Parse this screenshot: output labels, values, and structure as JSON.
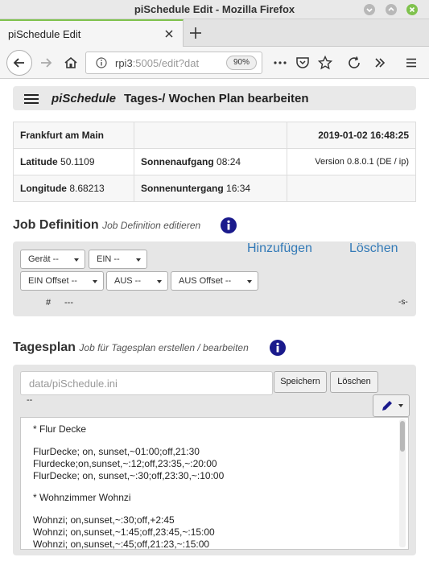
{
  "window": {
    "title": "piSchedule Edit - Mozilla Firefox"
  },
  "tab": {
    "title": "piSchedule Edit"
  },
  "urlbar": {
    "url_host": "rpi3",
    "url_rest": ":5005/edit?dat",
    "zoom": "90%"
  },
  "app": {
    "brand": "piSchedule",
    "title": "Tages-/ Wochen Plan bearbeiten"
  },
  "info": {
    "city": "Frankfurt am Main",
    "datetime": "2019-01-02 16:48:25",
    "lat_label": "Latitude",
    "lat_value": "50.1109",
    "sunrise_label": "Sonnenaufgang",
    "sunrise_value": "08:24",
    "version": "Version 0.8.0.1 (DE / ip)",
    "lon_label": "Longitude",
    "lon_value": "8.68213",
    "sunset_label": "Sonnenuntergang",
    "sunset_value": "16:34"
  },
  "job": {
    "title": "Job Definition",
    "subtitle": "Job Definition editieren",
    "add_label": "Hinzufügen",
    "delete_label": "Löschen",
    "dropdowns": {
      "geraet": "Gerät  --",
      "ein": "EIN  --",
      "ein_offset": "EIN Offset  --",
      "aus": "AUS  --",
      "aus_offset": "AUS Offset  --"
    },
    "hash": "#",
    "hash_value": "---",
    "s_label": "-s-"
  },
  "plan": {
    "title": "Tagesplan",
    "subtitle": "Job für Tagesplan erstellen / bearbeiten",
    "file_placeholder": "data/piSchedule.ini",
    "save_label": "Speichern",
    "delete_label": "Löschen",
    "status": "--",
    "lines": [
      "* Flur Decke",
      "",
      "FlurDecke; on, sunset,~01:00;off,21:30",
      "Flurdecke;on,sunset,~:12;off,23:35,~:20:00",
      "FlurDecke; on, sunset,~:30;off,23:30,~:10:00",
      "",
      "* Wohnzimmer Wohnzi",
      "",
      "Wohnzi; on,sunset,~:30;off,+2:45",
      "Wohnzi; on,sunset,~1:45;off,23:45,~:15:00",
      "Wohnzi; on,sunset,~:45;off,21:23,~:15:00"
    ]
  },
  "colors": {
    "accent_green": "#7fc24d",
    "link_blue": "#337ab7",
    "info_navy": "#1a1a8c"
  }
}
